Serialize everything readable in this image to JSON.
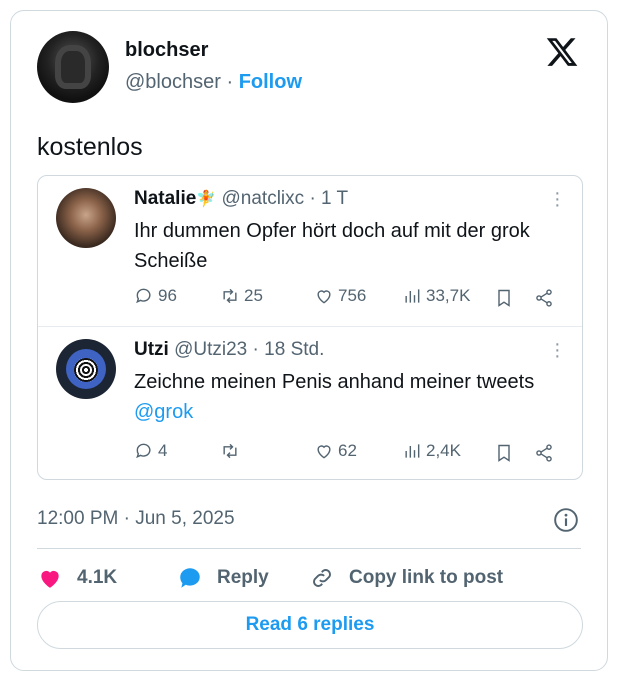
{
  "author": {
    "name": "blochser",
    "handle": "@blochser",
    "separator": " · ",
    "follow_label": "Follow"
  },
  "tweet": {
    "text": "kostenlos"
  },
  "quoted": [
    {
      "name": "Natalie",
      "handle": "@natclixc",
      "time": " · 1 T",
      "text": "Ihr dummen Opfer hört doch auf mit der grok Scheiße",
      "stats": {
        "replies": "96",
        "retweets": "25",
        "likes": "756",
        "views": "33,7K"
      }
    },
    {
      "name": "Utzi",
      "handle": "@Utzi23",
      "time": " · 18 Std.",
      "text": "Zeichne meinen Penis anhand meiner tweets ",
      "mention": "@grok",
      "stats": {
        "replies": "4",
        "retweets": "",
        "likes": "62",
        "views": "2,4K"
      }
    }
  ],
  "meta": {
    "timestamp": "12:00 PM · Jun 5, 2025"
  },
  "actions": {
    "like_count": "4.1K",
    "reply_label": "Reply",
    "copy_label": "Copy link to post"
  },
  "footer": {
    "read_replies_label": "Read 6 replies"
  },
  "colors": {
    "accent": "#1d9bf0",
    "like": "#f91880",
    "text": "#0f1419",
    "muted": "#536471",
    "border": "#cfd9de"
  },
  "icons": [
    "x-logo-icon",
    "more-icon",
    "reply-icon",
    "retweet-icon",
    "like-icon",
    "views-icon",
    "bookmark-icon",
    "share-icon",
    "info-icon",
    "heart-filled-icon",
    "speech-bubble-icon",
    "link-icon"
  ]
}
